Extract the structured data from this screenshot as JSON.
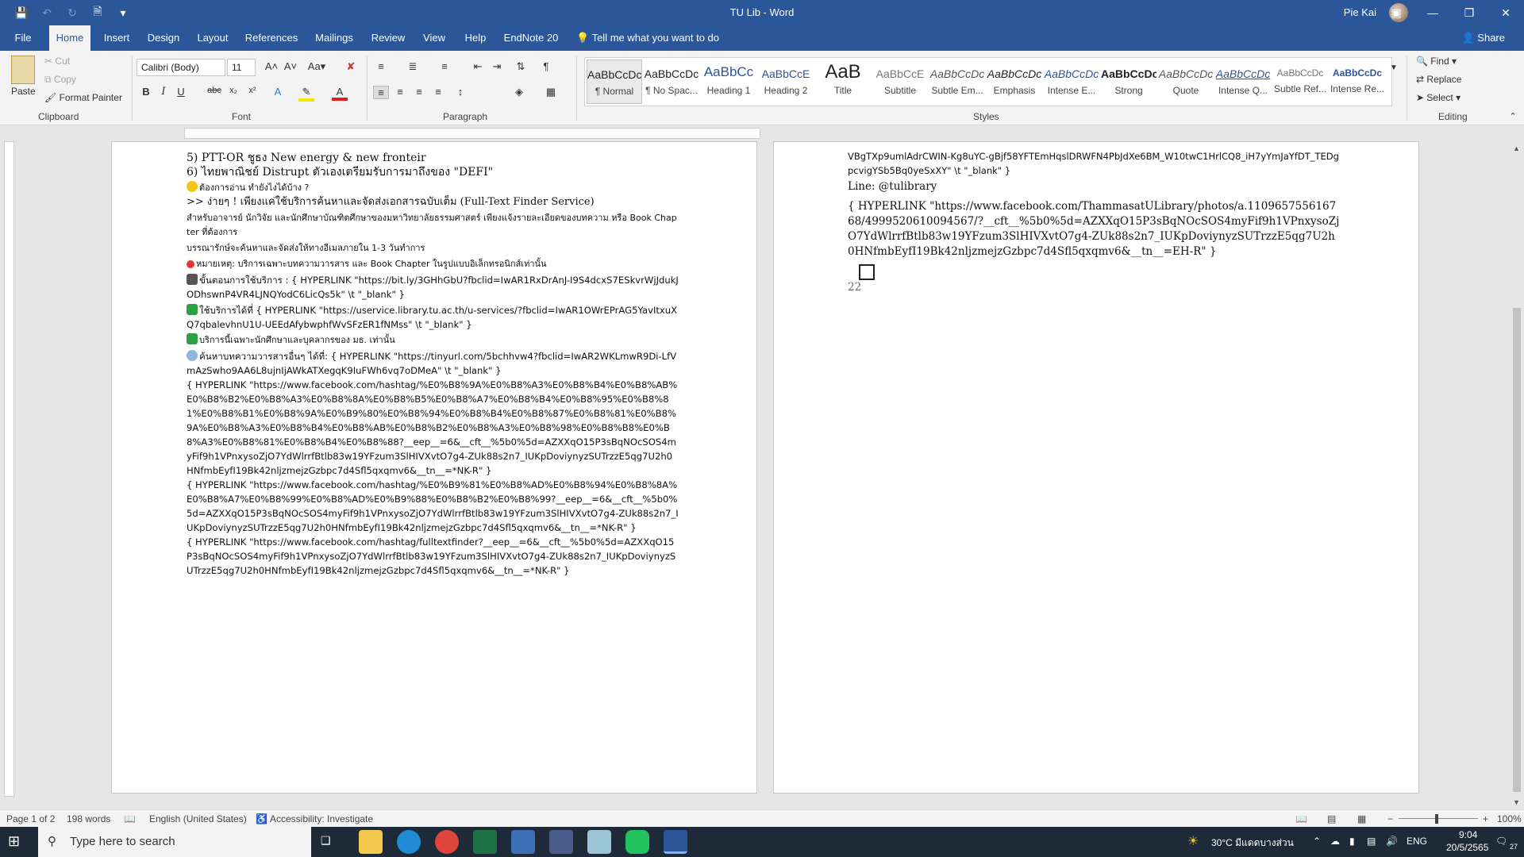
{
  "window": {
    "title": "TU Lib  -  Word",
    "user": "Pie Kai"
  },
  "menu": {
    "tabs": [
      "File",
      "Home",
      "Insert",
      "Design",
      "Layout",
      "References",
      "Mailings",
      "Review",
      "View",
      "Help",
      "EndNote 20"
    ],
    "active_tab": "Home",
    "tell_me": "Tell me what you want to do",
    "share": "Share"
  },
  "ribbon": {
    "clipboard": {
      "paste": "Paste",
      "cut": "Cut",
      "copy": "Copy",
      "format_painter": "Format Painter",
      "label": "Clipboard"
    },
    "font": {
      "name": "Calibri (Body)",
      "size": "11",
      "label": "Font"
    },
    "paragraph": {
      "label": "Paragraph"
    },
    "styles": {
      "label": "Styles",
      "items": [
        {
          "sample": "AaBbCcDc",
          "name": "¶ Normal"
        },
        {
          "sample": "AaBbCcDc",
          "name": "¶ No Spac..."
        },
        {
          "sample": "AaBbCc",
          "name": "Heading 1"
        },
        {
          "sample": "AaBbCcE",
          "name": "Heading 2"
        },
        {
          "sample": "AaB",
          "name": "Title"
        },
        {
          "sample": "AaBbCcE",
          "name": "Subtitle"
        },
        {
          "sample": "AaBbCcDc",
          "name": "Subtle Em..."
        },
        {
          "sample": "AaBbCcDc",
          "name": "Emphasis"
        },
        {
          "sample": "AaBbCcDc",
          "name": "Intense E..."
        },
        {
          "sample": "AaBbCcDc",
          "name": "Strong"
        },
        {
          "sample": "AaBbCcDc",
          "name": "Quote"
        },
        {
          "sample": "AaBbCcDc",
          "name": "Intense Q..."
        },
        {
          "sample": "AaBbCcDc",
          "name": "Subtle Ref..."
        },
        {
          "sample": "AaBbCcDc",
          "name": "Intense Re..."
        }
      ]
    },
    "editing": {
      "find": "Find",
      "replace": "Replace",
      "select": "Select",
      "label": "Editing"
    }
  },
  "page1": {
    "lines": [
      "5) PTT-OR ชูธง New energy & new fronteir",
      "6) ไทยพาณิชย์ Distrupt ตัวเองเตรียมรับการมาถึงของ \"DEFI\"",
      "ต้องการอ่าน ทำยังไงได้บ้าง ?",
      ">> ง่ายๆ ! เพียงแค่ใช้บริการค้นหาและจัดส่งเอกสารฉบับเต็ม (Full-Text Finder Service)",
      "สำหรับอาจารย์ นักวิจัย และนักศึกษาบัณฑิตศึกษาของมหาวิทยาลัยธรรมศาสตร์ เพียงแจ้งรายละเอียดของบทความ หรือ Book Chapter ที่ต้องการ",
      "บรรณารักษ์จะค้นหาและจัดส่งให้ทางอีเมลภายใน 1-3 วันทำการ",
      "หมายเหตุ: บริการเฉพาะบทความวารสาร และ Book Chapter ในรูปแบบอิเล็กทรอนิกส์เท่านั้น",
      "ขั้นตอนการใช้บริการ : { HYPERLINK \"https://bit.ly/3GHhGbU?fbclid=IwAR1RxDrAnJ-I9S4dcxS7ESkvrWjJdukJODhswnP4VR4LJNQYodC6LicQs5k\" \\t \"_blank\" }",
      "ใช้บริการได้ที่ { HYPERLINK \"https://uservice.library.tu.ac.th/u-services/?fbclid=IwAR1OWrEPrAG5YavItxuXQ7qbalevhnU1U-UEEdAfybwphfWvSFzER1fNMss\" \\t \"_blank\" }",
      "บริการนี้เฉพาะนักศึกษาและบุคลากรของ มธ. เท่านั้น",
      "ค้นหาบทความวารสารอื่นๆ ได้ที่: { HYPERLINK \"https://tinyurl.com/5bchhvw4?fbclid=IwAR2WKLmwR9Di-LfVmAzSwho9AA6L8ujnIjAWkATXegqK9IuFWh6vq7oDMeA\" \\t \"_blank\" }",
      "{ HYPERLINK \"https://www.facebook.com/hashtag/%E0%B8%9A%E0%B8%A3%E0%B8%B4%E0%B8%AB%E0%B8%B2%E0%B8%A3%E0%B8%8A%E0%B8%B5%E0%B8%A7%E0%B8%B4%E0%B8%95%E0%B8%81%E0%B8%B1%E0%B8%9A%E0%B9%80%E0%B8%94%E0%B8%B4%E0%B8%87%E0%B8%81%E0%B8%9A%E0%B8%A3%E0%B8%B4%E0%B8%AB%E0%B8%B2%E0%B8%A3%E0%B8%98%E0%B8%B8%E0%B8%A3%E0%B8%81%E0%B8%B4%E0%B8%88?__eep__=6&__cft__%5b0%5d=AZXXqO15P3sBqNOcSOS4myFif9h1VPnxysoZjO7YdWlrrfBtlb83w19YFzum3SlHIVXvtO7g4-ZUk88s2n7_IUKpDoviynyzSUTrzzE5qg7U2h0HNfmbEyfI19Bk42nljzmejzGzbpc7d4Sfl5qxqmv6&__tn__=*NK-R\" }",
      "{ HYPERLINK \"https://www.facebook.com/hashtag/%E0%B9%81%E0%B8%AD%E0%B8%94%E0%B8%8A%E0%B8%A7%E0%B8%99%E0%B8%AD%E0%B9%88%E0%B8%B2%E0%B8%99?__eep__=6&__cft__%5b0%5d=AZXXqO15P3sBqNOcSOS4myFif9h1VPnxysoZjO7YdWlrrfBtlb83w19YFzum3SlHIVXvtO7g4-ZUk88s2n7_IUKpDoviynyzSUTrzzE5qg7U2h0HNfmbEyfI19Bk42nljzmejzGzbpc7d4Sfl5qxqmv6&__tn__=*NK-R\" }",
      "{ HYPERLINK \"https://www.facebook.com/hashtag/fulltextfinder?__eep__=6&__cft__%5b0%5d=AZXXqO15P3sBqNOcSOS4myFif9h1VPnxysoZjO7YdWlrrfBtlb83w19YFzum3SlHIVXvtO7g4-ZUk88s2n7_IUKpDoviynyzSUTrzzE5qg7U2h0HNfmbEyfI19Bk42nljzmejzGzbpc7d4Sfl5qxqmv6&__tn__=*NK-R\" }"
    ]
  },
  "page2": {
    "lines": [
      "VBgTXp9umlAdrCWIN-Kg8uYC-gBjf58YFTEmHqslDRWFN4PbJdXe6BM_W10twC1HrlCQ8_iH7yYmJaYfDT_TEDgpcvigYSb5Bq0yeSxXY\" \\t \"_blank\" }",
      "Line: @tulibrary",
      "{ HYPERLINK \"https://www.facebook.com/ThammasatULibrary/photos/a.110965755616768/4999520610094567/?__cft__%5b0%5d=AZXXqO15P3sBqNOcSOS4myFif9h1VPnxysoZjO7YdWlrrfBtlb83w19YFzum3SlHIVXvtO7g4-ZUk88s2n7_IUKpDoviynyzSUTrzzE5qg7U2h0HNfmbEyfI19Bk42nljzmejzGzbpc7d4Sfl5qxqmv6&__tn__=EH-R\" }",
      "22"
    ]
  },
  "status": {
    "page": "Page 1 of 2",
    "words": "198 words",
    "language": "English (United States)",
    "accessibility": "Accessibility: Investigate",
    "zoom": "100%"
  },
  "taskbar": {
    "search_placeholder": "Type here to search",
    "weather": "30°C  มีแดดบางส่วน",
    "lang": "ENG",
    "time": "9:04",
    "date": "20/5/2565",
    "notifications": "27"
  }
}
